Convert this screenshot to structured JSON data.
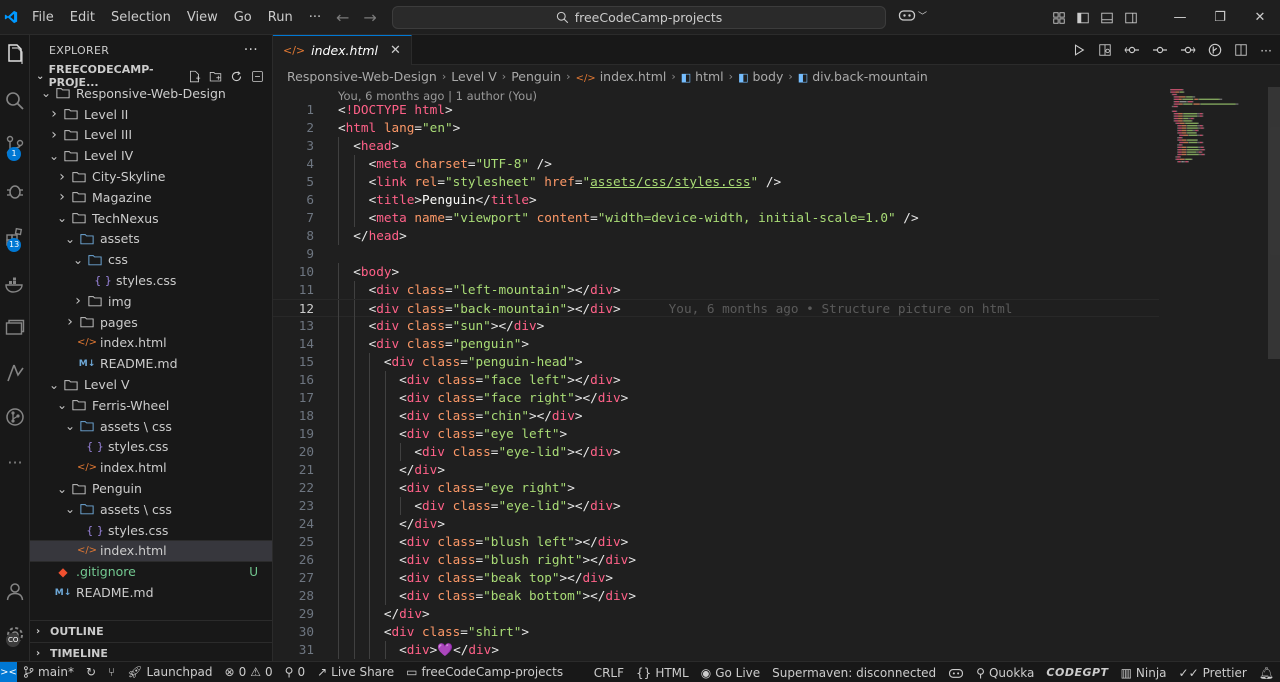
{
  "titlebar": {
    "menu": [
      "File",
      "Edit",
      "Selection",
      "View",
      "Go",
      "Run",
      "···"
    ],
    "search_text": "freeCodeCamp-projects"
  },
  "activity": {
    "scm_badge": "1",
    "extensions_badge": "13",
    "accounts_badge": "CO"
  },
  "sidebar": {
    "title": "EXPLORER",
    "more": "···",
    "root_label": "FREECODECAMP-PROJE...",
    "tree": [
      {
        "label": "Responsive-Web-Design",
        "type": "folder",
        "open": true,
        "depth": 1
      },
      {
        "label": "Level II",
        "type": "folder",
        "open": false,
        "depth": 2
      },
      {
        "label": "Level III",
        "type": "folder",
        "open": false,
        "depth": 2
      },
      {
        "label": "Level IV",
        "type": "folder",
        "open": true,
        "depth": 2
      },
      {
        "label": "City-Skyline",
        "type": "folder",
        "open": false,
        "depth": 3
      },
      {
        "label": "Magazine",
        "type": "folder",
        "open": false,
        "depth": 3
      },
      {
        "label": "TechNexus",
        "type": "folder",
        "open": true,
        "depth": 3
      },
      {
        "label": "assets",
        "type": "folder-special",
        "open": true,
        "depth": 4
      },
      {
        "label": "css",
        "type": "folder-special",
        "open": true,
        "depth": 5
      },
      {
        "label": "styles.css",
        "type": "css",
        "depth": 6
      },
      {
        "label": "img",
        "type": "folder",
        "open": false,
        "depth": 5
      },
      {
        "label": "pages",
        "type": "folder",
        "open": false,
        "depth": 4
      },
      {
        "label": "index.html",
        "type": "html",
        "depth": 4
      },
      {
        "label": "README.md",
        "type": "md",
        "depth": 4
      },
      {
        "label": "Level V",
        "type": "folder",
        "open": true,
        "depth": 2
      },
      {
        "label": "Ferris-Wheel",
        "type": "folder",
        "open": true,
        "depth": 3
      },
      {
        "label": "assets \\ css",
        "type": "folder-special",
        "open": true,
        "depth": 4
      },
      {
        "label": "styles.css",
        "type": "css",
        "depth": 5
      },
      {
        "label": "index.html",
        "type": "html",
        "depth": 4
      },
      {
        "label": "Penguin",
        "type": "folder",
        "open": true,
        "depth": 3
      },
      {
        "label": "assets \\ css",
        "type": "folder-special",
        "open": true,
        "depth": 4
      },
      {
        "label": "styles.css",
        "type": "css",
        "depth": 5
      },
      {
        "label": "index.html",
        "type": "html",
        "depth": 4,
        "selected": true
      },
      {
        "label": ".gitignore",
        "type": "git",
        "depth": 1,
        "status": "U"
      },
      {
        "label": "README.md",
        "type": "md",
        "depth": 1
      }
    ],
    "outline_label": "OUTLINE",
    "timeline_label": "TIMELINE"
  },
  "editor": {
    "tab_label": "index.html",
    "breadcrumbs": [
      "Responsive-Web-Design",
      "Level V",
      "Penguin",
      "index.html",
      "html",
      "body",
      "div.back-mountain"
    ],
    "codelens": "You, 6 months ago | 1 author (You)",
    "current_line": 12,
    "blame": "You, 6 months ago • Structure picture on html",
    "lines": [
      [
        [
          "t-punc",
          "<"
        ],
        [
          "t-tag",
          "!DOCTYPE html"
        ],
        [
          "t-punc",
          ">"
        ]
      ],
      [
        [
          "t-punc",
          "<"
        ],
        [
          "t-tag",
          "html "
        ],
        [
          "t-attr",
          "lang"
        ],
        [
          "t-punc",
          "="
        ],
        [
          "t-str",
          "\"en\""
        ],
        [
          "t-punc",
          ">"
        ]
      ],
      [
        [
          "t-text",
          "  "
        ],
        [
          "t-punc",
          "<"
        ],
        [
          "t-tag",
          "head"
        ],
        [
          "t-punc",
          ">"
        ]
      ],
      [
        [
          "t-text",
          "    "
        ],
        [
          "t-punc",
          "<"
        ],
        [
          "t-tag",
          "meta "
        ],
        [
          "t-attr",
          "charset"
        ],
        [
          "t-punc",
          "="
        ],
        [
          "t-str",
          "\"UTF-8\""
        ],
        [
          "t-punc",
          " />"
        ]
      ],
      [
        [
          "t-text",
          "    "
        ],
        [
          "t-punc",
          "<"
        ],
        [
          "t-tag",
          "link "
        ],
        [
          "t-attr",
          "rel"
        ],
        [
          "t-punc",
          "="
        ],
        [
          "t-str",
          "\"stylesheet\""
        ],
        [
          "t-text",
          " "
        ],
        [
          "t-attr",
          "href"
        ],
        [
          "t-punc",
          "="
        ],
        [
          "t-str",
          "\""
        ],
        [
          "t-link",
          "assets/css/styles.css"
        ],
        [
          "t-str",
          "\""
        ],
        [
          "t-punc",
          " />"
        ]
      ],
      [
        [
          "t-text",
          "    "
        ],
        [
          "t-punc",
          "<"
        ],
        [
          "t-tag",
          "title"
        ],
        [
          "t-punc",
          ">"
        ],
        [
          "t-text",
          "Penguin"
        ],
        [
          "t-punc",
          "</"
        ],
        [
          "t-tag",
          "title"
        ],
        [
          "t-punc",
          ">"
        ]
      ],
      [
        [
          "t-text",
          "    "
        ],
        [
          "t-punc",
          "<"
        ],
        [
          "t-tag",
          "meta "
        ],
        [
          "t-attr",
          "name"
        ],
        [
          "t-punc",
          "="
        ],
        [
          "t-str",
          "\"viewport\""
        ],
        [
          "t-text",
          " "
        ],
        [
          "t-attr",
          "content"
        ],
        [
          "t-punc",
          "="
        ],
        [
          "t-str",
          "\"width=device-width, initial-scale=1.0\""
        ],
        [
          "t-punc",
          " />"
        ]
      ],
      [
        [
          "t-text",
          "  "
        ],
        [
          "t-punc",
          "</"
        ],
        [
          "t-tag",
          "head"
        ],
        [
          "t-punc",
          ">"
        ]
      ],
      [],
      [
        [
          "t-text",
          "  "
        ],
        [
          "t-punc",
          "<"
        ],
        [
          "t-tag",
          "body"
        ],
        [
          "t-punc",
          ">"
        ]
      ],
      [
        [
          "t-text",
          "    "
        ],
        [
          "t-punc",
          "<"
        ],
        [
          "t-tag",
          "div "
        ],
        [
          "t-attr",
          "class"
        ],
        [
          "t-punc",
          "="
        ],
        [
          "t-str",
          "\"left-mountain\""
        ],
        [
          "t-punc",
          "></"
        ],
        [
          "t-tag",
          "div"
        ],
        [
          "t-punc",
          ">"
        ]
      ],
      [
        [
          "t-text",
          "    "
        ],
        [
          "t-punc",
          "<"
        ],
        [
          "t-tag",
          "div "
        ],
        [
          "t-attr",
          "class"
        ],
        [
          "t-punc",
          "="
        ],
        [
          "t-str",
          "\"back-mountain\""
        ],
        [
          "t-punc",
          "></"
        ],
        [
          "t-tag",
          "div"
        ],
        [
          "t-punc",
          ">"
        ]
      ],
      [
        [
          "t-text",
          "    "
        ],
        [
          "t-punc",
          "<"
        ],
        [
          "t-tag",
          "div "
        ],
        [
          "t-attr",
          "class"
        ],
        [
          "t-punc",
          "="
        ],
        [
          "t-str",
          "\"sun\""
        ],
        [
          "t-punc",
          "></"
        ],
        [
          "t-tag",
          "div"
        ],
        [
          "t-punc",
          ">"
        ]
      ],
      [
        [
          "t-text",
          "    "
        ],
        [
          "t-punc",
          "<"
        ],
        [
          "t-tag",
          "div "
        ],
        [
          "t-attr",
          "class"
        ],
        [
          "t-punc",
          "="
        ],
        [
          "t-str",
          "\"penguin\""
        ],
        [
          "t-punc",
          ">"
        ]
      ],
      [
        [
          "t-text",
          "      "
        ],
        [
          "t-punc",
          "<"
        ],
        [
          "t-tag",
          "div "
        ],
        [
          "t-attr",
          "class"
        ],
        [
          "t-punc",
          "="
        ],
        [
          "t-str",
          "\"penguin-head\""
        ],
        [
          "t-punc",
          ">"
        ]
      ],
      [
        [
          "t-text",
          "        "
        ],
        [
          "t-punc",
          "<"
        ],
        [
          "t-tag",
          "div "
        ],
        [
          "t-attr",
          "class"
        ],
        [
          "t-punc",
          "="
        ],
        [
          "t-str",
          "\"face left\""
        ],
        [
          "t-punc",
          "></"
        ],
        [
          "t-tag",
          "div"
        ],
        [
          "t-punc",
          ">"
        ]
      ],
      [
        [
          "t-text",
          "        "
        ],
        [
          "t-punc",
          "<"
        ],
        [
          "t-tag",
          "div "
        ],
        [
          "t-attr",
          "class"
        ],
        [
          "t-punc",
          "="
        ],
        [
          "t-str",
          "\"face right\""
        ],
        [
          "t-punc",
          "></"
        ],
        [
          "t-tag",
          "div"
        ],
        [
          "t-punc",
          ">"
        ]
      ],
      [
        [
          "t-text",
          "        "
        ],
        [
          "t-punc",
          "<"
        ],
        [
          "t-tag",
          "div "
        ],
        [
          "t-attr",
          "class"
        ],
        [
          "t-punc",
          "="
        ],
        [
          "t-str",
          "\"chin\""
        ],
        [
          "t-punc",
          "></"
        ],
        [
          "t-tag",
          "div"
        ],
        [
          "t-punc",
          ">"
        ]
      ],
      [
        [
          "t-text",
          "        "
        ],
        [
          "t-punc",
          "<"
        ],
        [
          "t-tag",
          "div "
        ],
        [
          "t-attr",
          "class"
        ],
        [
          "t-punc",
          "="
        ],
        [
          "t-str",
          "\"eye left\""
        ],
        [
          "t-punc",
          ">"
        ]
      ],
      [
        [
          "t-text",
          "          "
        ],
        [
          "t-punc",
          "<"
        ],
        [
          "t-tag",
          "div "
        ],
        [
          "t-attr",
          "class"
        ],
        [
          "t-punc",
          "="
        ],
        [
          "t-str",
          "\"eye-lid\""
        ],
        [
          "t-punc",
          "></"
        ],
        [
          "t-tag",
          "div"
        ],
        [
          "t-punc",
          ">"
        ]
      ],
      [
        [
          "t-text",
          "        "
        ],
        [
          "t-punc",
          "</"
        ],
        [
          "t-tag",
          "div"
        ],
        [
          "t-punc",
          ">"
        ]
      ],
      [
        [
          "t-text",
          "        "
        ],
        [
          "t-punc",
          "<"
        ],
        [
          "t-tag",
          "div "
        ],
        [
          "t-attr",
          "class"
        ],
        [
          "t-punc",
          "="
        ],
        [
          "t-str",
          "\"eye right\""
        ],
        [
          "t-punc",
          ">"
        ]
      ],
      [
        [
          "t-text",
          "          "
        ],
        [
          "t-punc",
          "<"
        ],
        [
          "t-tag",
          "div "
        ],
        [
          "t-attr",
          "class"
        ],
        [
          "t-punc",
          "="
        ],
        [
          "t-str",
          "\"eye-lid\""
        ],
        [
          "t-punc",
          "></"
        ],
        [
          "t-tag",
          "div"
        ],
        [
          "t-punc",
          ">"
        ]
      ],
      [
        [
          "t-text",
          "        "
        ],
        [
          "t-punc",
          "</"
        ],
        [
          "t-tag",
          "div"
        ],
        [
          "t-punc",
          ">"
        ]
      ],
      [
        [
          "t-text",
          "        "
        ],
        [
          "t-punc",
          "<"
        ],
        [
          "t-tag",
          "div "
        ],
        [
          "t-attr",
          "class"
        ],
        [
          "t-punc",
          "="
        ],
        [
          "t-str",
          "\"blush left\""
        ],
        [
          "t-punc",
          "></"
        ],
        [
          "t-tag",
          "div"
        ],
        [
          "t-punc",
          ">"
        ]
      ],
      [
        [
          "t-text",
          "        "
        ],
        [
          "t-punc",
          "<"
        ],
        [
          "t-tag",
          "div "
        ],
        [
          "t-attr",
          "class"
        ],
        [
          "t-punc",
          "="
        ],
        [
          "t-str",
          "\"blush right\""
        ],
        [
          "t-punc",
          "></"
        ],
        [
          "t-tag",
          "div"
        ],
        [
          "t-punc",
          ">"
        ]
      ],
      [
        [
          "t-text",
          "        "
        ],
        [
          "t-punc",
          "<"
        ],
        [
          "t-tag",
          "div "
        ],
        [
          "t-attr",
          "class"
        ],
        [
          "t-punc",
          "="
        ],
        [
          "t-str",
          "\"beak top\""
        ],
        [
          "t-punc",
          "></"
        ],
        [
          "t-tag",
          "div"
        ],
        [
          "t-punc",
          ">"
        ]
      ],
      [
        [
          "t-text",
          "        "
        ],
        [
          "t-punc",
          "<"
        ],
        [
          "t-tag",
          "div "
        ],
        [
          "t-attr",
          "class"
        ],
        [
          "t-punc",
          "="
        ],
        [
          "t-str",
          "\"beak bottom\""
        ],
        [
          "t-punc",
          "></"
        ],
        [
          "t-tag",
          "div"
        ],
        [
          "t-punc",
          ">"
        ]
      ],
      [
        [
          "t-text",
          "      "
        ],
        [
          "t-punc",
          "</"
        ],
        [
          "t-tag",
          "div"
        ],
        [
          "t-punc",
          ">"
        ]
      ],
      [
        [
          "t-text",
          "      "
        ],
        [
          "t-punc",
          "<"
        ],
        [
          "t-tag",
          "div "
        ],
        [
          "t-attr",
          "class"
        ],
        [
          "t-punc",
          "="
        ],
        [
          "t-str",
          "\"shirt\""
        ],
        [
          "t-punc",
          ">"
        ]
      ],
      [
        [
          "t-text",
          "        "
        ],
        [
          "t-punc",
          "<"
        ],
        [
          "t-tag",
          "div"
        ],
        [
          "t-punc",
          ">"
        ],
        [
          "t-text",
          "💜"
        ],
        [
          "t-punc",
          "</"
        ],
        [
          "t-tag",
          "div"
        ],
        [
          "t-punc",
          ">"
        ]
      ]
    ]
  },
  "statusbar": {
    "branch": "main*",
    "launchpad": "Launchpad",
    "errors": "0",
    "warnings": "0",
    "ports": "0",
    "live_share": "Live Share",
    "workspace": "freeCodeCamp-projects",
    "eol": "CRLF",
    "language": "HTML",
    "go_live": "Go Live",
    "supermaven": "Supermaven: disconnected",
    "quokka": "Quokka",
    "codegpt": "CODEGPT",
    "ninja": "Ninja",
    "prettier": "Prettier"
  },
  "colors": {
    "accent": "#0078d4",
    "tag": "#ff6188",
    "attribute": "#fc9867",
    "string": "#a9dc76",
    "untracked": "#73c991"
  }
}
